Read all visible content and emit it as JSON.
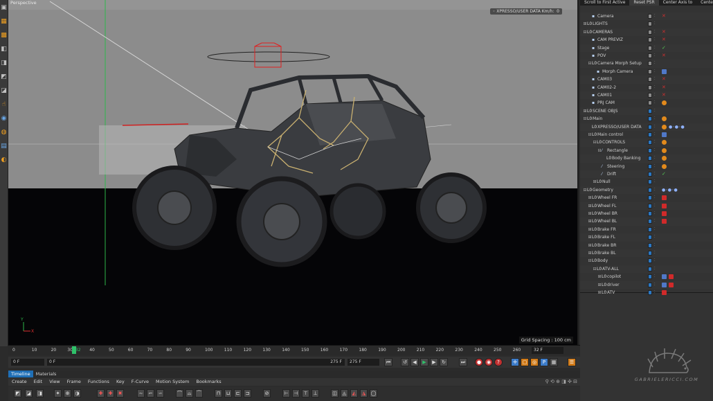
{
  "viewport": {
    "label": "Perspective",
    "hud": "XPRESSO/USER DATA Km/h:",
    "hud_value": "0",
    "grid_spacing": "Grid Spacing : 100 cm"
  },
  "object_manager": {
    "toolbar": [
      "Scroll to First Active",
      "Reset PSR",
      "Center Axis to",
      "Center"
    ],
    "rows": [
      {
        "name": "Camera",
        "indent": 1,
        "icon": "camera",
        "exp": "",
        "tags": [
          "x"
        ]
      },
      {
        "name": "LIGHTS",
        "indent": 0,
        "icon": "null",
        "exp": "+",
        "tags": []
      },
      {
        "name": "CAMERAS",
        "indent": 0,
        "icon": "null",
        "exp": "-",
        "tags": [
          "x"
        ]
      },
      {
        "name": "CAM PREVIZ",
        "indent": 1,
        "icon": "camera",
        "exp": "",
        "tags": [
          "x"
        ]
      },
      {
        "name": "Stage",
        "indent": 1,
        "icon": "camera",
        "exp": "",
        "tags": [
          "check"
        ]
      },
      {
        "name": "POV",
        "indent": 1,
        "icon": "camera",
        "exp": "",
        "tags": [
          "x"
        ]
      },
      {
        "name": "Camera Morph Setup",
        "indent": 1,
        "icon": "null",
        "exp": "-",
        "tags": []
      },
      {
        "name": "Morph Camera",
        "indent": 2,
        "icon": "camera",
        "exp": "",
        "tags": [
          "bluew"
        ]
      },
      {
        "name": "CAM03",
        "indent": 1,
        "icon": "camera",
        "exp": "",
        "tags": [
          "x"
        ]
      },
      {
        "name": "CAM02-2",
        "indent": 1,
        "icon": "camera",
        "exp": "",
        "tags": [
          "x"
        ]
      },
      {
        "name": "CAM01",
        "indent": 1,
        "icon": "camera",
        "exp": "",
        "tags": [
          "x"
        ]
      },
      {
        "name": "PRJ CAM",
        "indent": 1,
        "icon": "camera",
        "exp": "",
        "tags": [
          "orange"
        ]
      },
      {
        "name": "SCENE OBJS",
        "indent": 0,
        "icon": "null",
        "exp": "+",
        "tags": []
      },
      {
        "name": "Main",
        "indent": 0,
        "icon": "null",
        "exp": "-",
        "tags": [
          "orange"
        ]
      },
      {
        "name": "XPRESSO/USER DATA",
        "indent": 1,
        "icon": "null",
        "exp": "",
        "tags": [
          "orange",
          "xpresso"
        ]
      },
      {
        "name": "Main control",
        "indent": 1,
        "icon": "null",
        "exp": "-",
        "tags": [
          "bluew"
        ]
      },
      {
        "name": "CONTROLS",
        "indent": 2,
        "icon": "null",
        "exp": "-",
        "tags": [
          "orange"
        ]
      },
      {
        "name": "Rectangle",
        "indent": 3,
        "icon": "spline",
        "exp": "-",
        "tags": [
          "orange"
        ]
      },
      {
        "name": "Body Banking",
        "indent": 4,
        "icon": "null",
        "exp": "",
        "tags": [
          "orange"
        ]
      },
      {
        "name": "Steering",
        "indent": 3,
        "icon": "spline",
        "exp": "",
        "tags": [
          "orange"
        ]
      },
      {
        "name": "Drift",
        "indent": 3,
        "icon": "spline",
        "exp": "",
        "tags": [
          "check"
        ]
      },
      {
        "name": "Null",
        "indent": 2,
        "icon": "null",
        "exp": "+",
        "tags": []
      },
      {
        "name": "Geometry",
        "indent": 0,
        "icon": "null",
        "exp": "-",
        "tags": [
          "xpresso"
        ]
      },
      {
        "name": "Wheel FR",
        "indent": 1,
        "icon": "null",
        "exp": "+",
        "tags": [
          "red"
        ]
      },
      {
        "name": "Wheel FL",
        "indent": 1,
        "icon": "null",
        "exp": "+",
        "tags": [
          "red"
        ]
      },
      {
        "name": "Wheel BR",
        "indent": 1,
        "icon": "null",
        "exp": "+",
        "tags": [
          "red"
        ]
      },
      {
        "name": "Wheel BL",
        "indent": 1,
        "icon": "null",
        "exp": "+",
        "tags": [
          "red"
        ]
      },
      {
        "name": "Brake FR",
        "indent": 1,
        "icon": "null",
        "exp": "+",
        "tags": []
      },
      {
        "name": "Brake FL",
        "indent": 1,
        "icon": "null",
        "exp": "+",
        "tags": []
      },
      {
        "name": "Brake BR",
        "indent": 1,
        "icon": "null",
        "exp": "+",
        "tags": []
      },
      {
        "name": "Brake BL",
        "indent": 1,
        "icon": "null",
        "exp": "+",
        "tags": []
      },
      {
        "name": "Body",
        "indent": 1,
        "icon": "null",
        "exp": "-",
        "tags": []
      },
      {
        "name": "ATV-ALL",
        "indent": 2,
        "icon": "null",
        "exp": "-",
        "tags": []
      },
      {
        "name": "copilot",
        "indent": 3,
        "icon": "null",
        "exp": "+",
        "tags": [
          "bluew",
          "red"
        ]
      },
      {
        "name": "driver",
        "indent": 3,
        "icon": "null",
        "exp": "+",
        "tags": [
          "bluew",
          "red"
        ]
      },
      {
        "name": "ATV",
        "indent": 3,
        "icon": "null",
        "exp": "+",
        "tags": [
          "red"
        ]
      }
    ]
  },
  "timeline": {
    "ticks": [
      "0",
      "10",
      "20",
      "30",
      "32",
      "40",
      "50",
      "60",
      "70",
      "80",
      "90",
      "100",
      "110",
      "120",
      "130",
      "140",
      "150",
      "160",
      "170",
      "180",
      "190",
      "200",
      "210",
      "220",
      "230",
      "240",
      "250",
      "260",
      "270"
    ],
    "current_frame": "32 F",
    "start_field": "0 F",
    "min_field": "0 F",
    "end_field": "275 F",
    "max_field": "275 F"
  },
  "tabs": [
    "Timeline",
    "Materials"
  ],
  "menu": [
    "Create",
    "Edit",
    "View",
    "Frame",
    "Functions",
    "Key",
    "F-Curve",
    "Motion System",
    "Bookmarks"
  ],
  "watermark": "GABRIELERICCI.COM"
}
